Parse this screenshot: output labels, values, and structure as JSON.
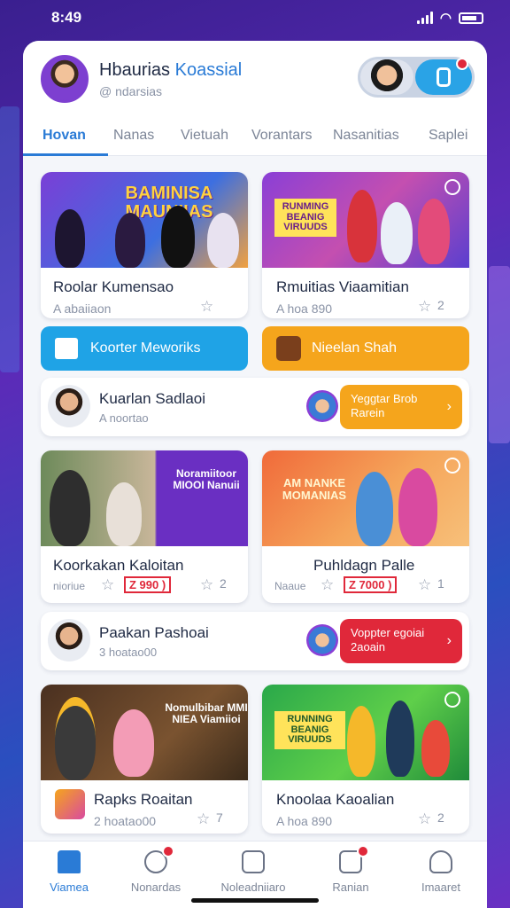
{
  "status": {
    "time": "8:49"
  },
  "header": {
    "title_part1": "Hbaurias ",
    "title_part2": "Koassial",
    "subtitle": "@ ndarsias"
  },
  "tabs": [
    "Hovan",
    "Nanas",
    "Vietuah",
    "Vorantars",
    "Nasanitias",
    "Saplei"
  ],
  "tiles": [
    {
      "title": "Roolar Kumensao",
      "meta": "A abaiiaon",
      "banner": "BAMINISA MAUNIIAS",
      "rating": ""
    },
    {
      "title": "Rmuitias Viaamitian",
      "meta": "A hoa 890",
      "banner": "RUNMING BEANIG VIRUUDS",
      "rating": "2"
    },
    {
      "title": "Koorkakan Kaloitan",
      "meta": "nioriue",
      "banner": "Noramiitoor MIOOI Nanuii",
      "price": "Z 990 )",
      "rating": "2"
    },
    {
      "title": "Puhldagn Palle",
      "meta": "Naaue",
      "banner": "AM NANKE MOMANIAS",
      "price": "Z 7000 )",
      "rating": "1"
    },
    {
      "title": "Rapks Roaitan",
      "meta": "2 hoatao00",
      "banner": "Nomulbibar MMI NIEA Viamiioi",
      "rating": "7"
    },
    {
      "title": "Knoolaa Kaoalian",
      "meta": "A hoa 890",
      "banner": "RUNNING BEANIG VIRUUDS",
      "rating": "2"
    }
  ],
  "buttons": {
    "memorials": "Koorter Meworiks",
    "share": "Nieelan Shah"
  },
  "rows": [
    {
      "title": "Kuarlan Sadlaoi",
      "sub": "A noortao",
      "cta_line1": "Yeggtar Brob",
      "cta_line2": "Rarein"
    },
    {
      "title": "Paakan Pashoai",
      "sub": "3 hoatao00",
      "cta_line1": "Voppter egoiai",
      "cta_line2": "2aoain"
    }
  ],
  "nav": [
    {
      "label": "Viamea",
      "icon": "home-icon"
    },
    {
      "label": "Nonardas",
      "icon": "chat-icon"
    },
    {
      "label": "Noleadniiaro",
      "icon": "document-icon"
    },
    {
      "label": "Ranian",
      "icon": "notification-icon"
    },
    {
      "label": "Imaaret",
      "icon": "profile-icon"
    }
  ],
  "colors": {
    "accent": "#2a7bd6",
    "blue_button": "#1fa3e6",
    "orange_button": "#f5a51c",
    "cta_red": "#e0283a",
    "purple": "#7d3fd0"
  }
}
